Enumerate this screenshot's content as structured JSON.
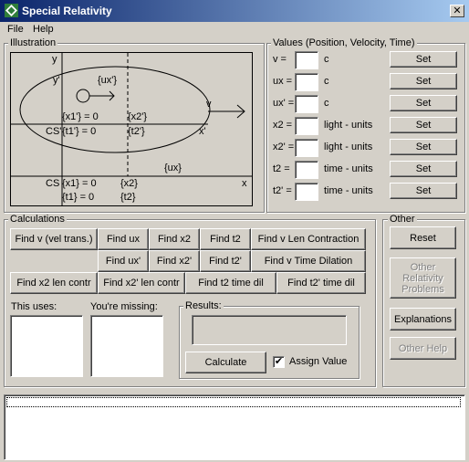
{
  "window": {
    "title": "Special Relativity",
    "close_glyph": "✕"
  },
  "menu": [
    "File",
    "Help"
  ],
  "illustration": {
    "title": "Illustration",
    "y_outer": "y",
    "y_inner": "y'",
    "ux_prime": "{ux'}",
    "v_label": "v",
    "x1_prime": "{x1'} = 0",
    "x2_prime": "{x2'}",
    "cs_prime": "CS'",
    "t1_prime": "{t1'} = 0",
    "t2_prime": "{t2'}",
    "x_prime_axis": "x'",
    "ux": "{ux}",
    "cs": "CS",
    "x1": "{x1} = 0",
    "x2": "{x2}",
    "x_axis": "x",
    "t1": "{t1} = 0",
    "t2": "{t2}"
  },
  "values": {
    "title": "Values (Position, Velocity, Time)",
    "rows": [
      {
        "label": "v =",
        "value": "",
        "unit": "c",
        "button": "Set"
      },
      {
        "label": "ux =",
        "value": "",
        "unit": "c",
        "button": "Set"
      },
      {
        "label": "ux' =",
        "value": "",
        "unit": "c",
        "button": "Set"
      },
      {
        "label": "x2 =",
        "value": "",
        "unit": "light - units",
        "button": "Set"
      },
      {
        "label": "x2' =",
        "value": "",
        "unit": "light - units",
        "button": "Set"
      },
      {
        "label": "t2 =",
        "value": "",
        "unit": "time - units",
        "button": "Set"
      },
      {
        "label": "t2' =",
        "value": "",
        "unit": "time - units",
        "button": "Set"
      }
    ]
  },
  "calculations": {
    "title": "Calculations",
    "buttons": {
      "find_v": "Find v (vel trans.)",
      "find_ux": "Find ux",
      "find_x2": "Find x2",
      "find_t2": "Find t2",
      "find_v_len": "Find v Len Contraction",
      "find_ux_p": "Find ux'",
      "find_x2_p": "Find x2'",
      "find_t2_p": "Find t2'",
      "find_v_time": "Find v Time Dilation",
      "find_x2_len": "Find x2 len contr",
      "find_x2p_len": "Find x2' len contr",
      "find_t2_time": "Find t2 time dil",
      "find_t2p_time": "Find t2' time dil"
    },
    "this_uses_label": "This uses:",
    "missing_label": "You're missing:",
    "results_title": "Results:",
    "calculate_label": "Calculate",
    "assign_label": "Assign Value",
    "assign_checked": true
  },
  "other": {
    "title": "Other",
    "reset": "Reset",
    "other_problems": "Other Relativity Problems",
    "explanations": "Explanations",
    "other_help": "Other Help"
  }
}
